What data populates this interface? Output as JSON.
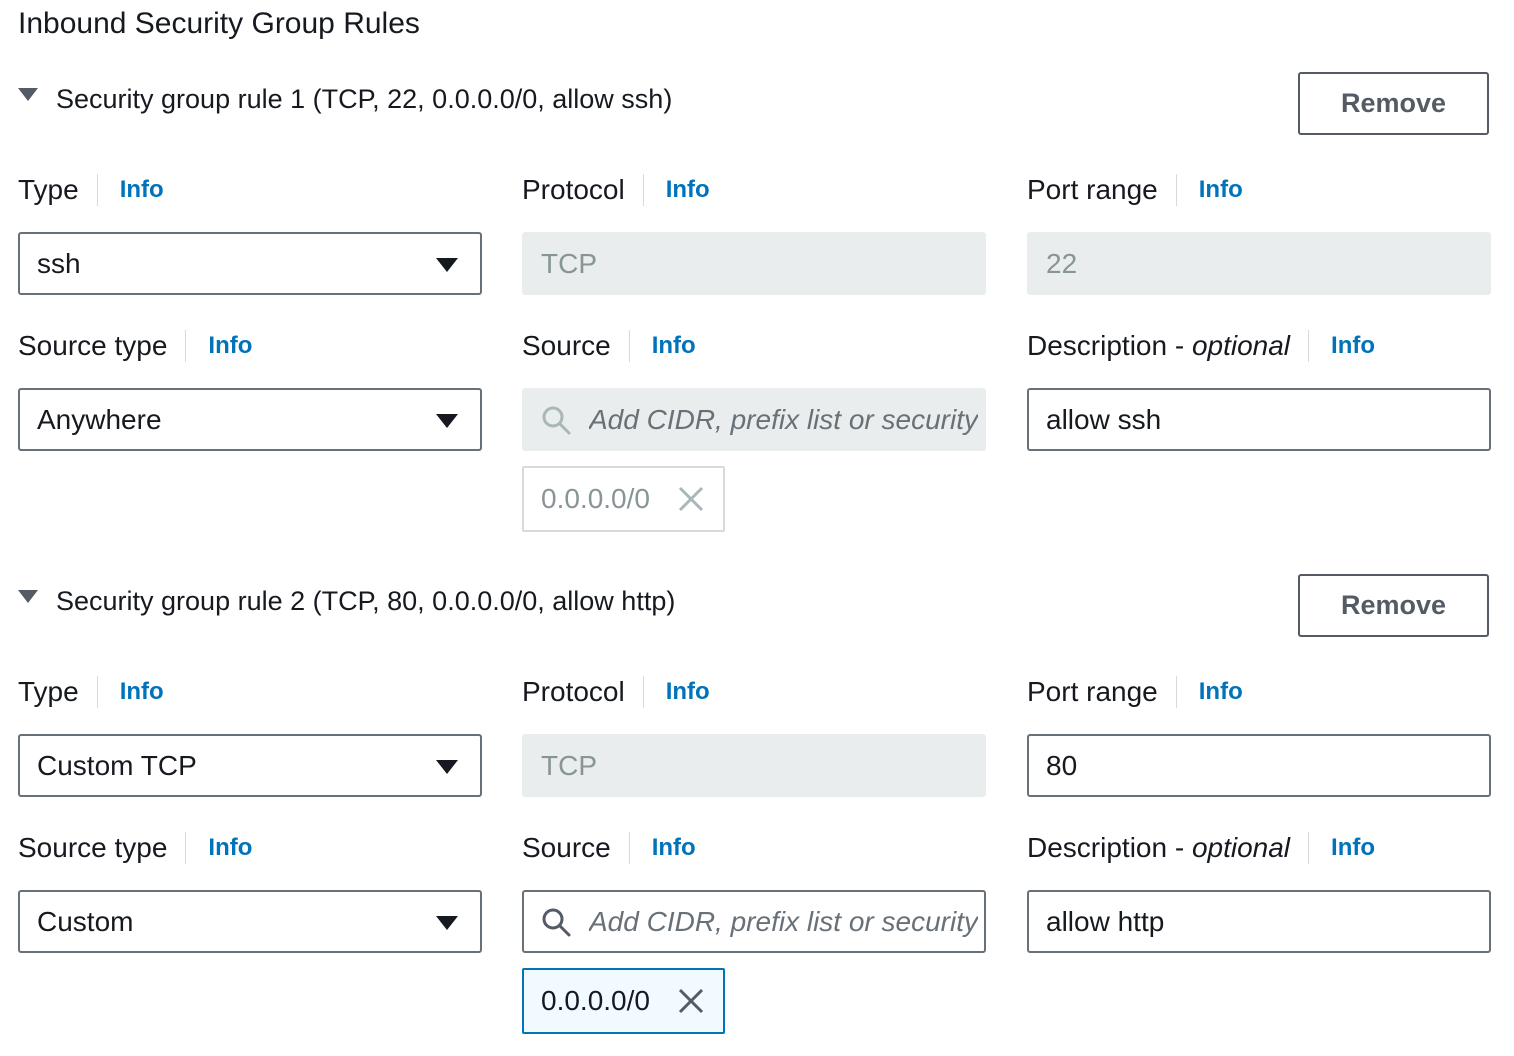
{
  "page": {
    "title": "Inbound Security Group Rules"
  },
  "rules": [
    {
      "header": "Security group rule 1 (TCP, 22, 0.0.0.0/0, allow ssh)",
      "remove_label": "Remove",
      "type": {
        "label": "Type",
        "info": "Info",
        "value": "ssh"
      },
      "protocol": {
        "label": "Protocol",
        "info": "Info",
        "value": "TCP"
      },
      "port_range": {
        "label": "Port range",
        "info": "Info",
        "value": "22",
        "disabled": true
      },
      "source_type": {
        "label": "Source type",
        "info": "Info",
        "value": "Anywhere"
      },
      "source": {
        "label": "Source",
        "info": "Info",
        "placeholder": "Add CIDR, prefix list or security",
        "disabled": true,
        "token": "0.0.0.0/0"
      },
      "description": {
        "label": "Description - ",
        "label_optional": "optional",
        "info": "Info",
        "value": "allow ssh"
      }
    },
    {
      "header": "Security group rule 2 (TCP, 80, 0.0.0.0/0, allow http)",
      "remove_label": "Remove",
      "type": {
        "label": "Type",
        "info": "Info",
        "value": "Custom TCP"
      },
      "protocol": {
        "label": "Protocol",
        "info": "Info",
        "value": "TCP"
      },
      "port_range": {
        "label": "Port range",
        "info": "Info",
        "value": "80",
        "disabled": false
      },
      "source_type": {
        "label": "Source type",
        "info": "Info",
        "value": "Custom"
      },
      "source": {
        "label": "Source",
        "info": "Info",
        "placeholder": "Add CIDR, prefix list or security",
        "disabled": false,
        "token": "0.0.0.0/0"
      },
      "description": {
        "label": "Description - ",
        "label_optional": "optional",
        "info": "Info",
        "value": "allow http"
      }
    }
  ],
  "colors": {
    "link": "#0073bb",
    "disabled_bg": "#eaeded",
    "border": "#687078",
    "token_active_bg": "#f1faff"
  },
  "icons": {
    "expand": "caret-down-icon",
    "select": "caret-down-icon",
    "search": "search-icon",
    "remove_token": "close-icon"
  }
}
